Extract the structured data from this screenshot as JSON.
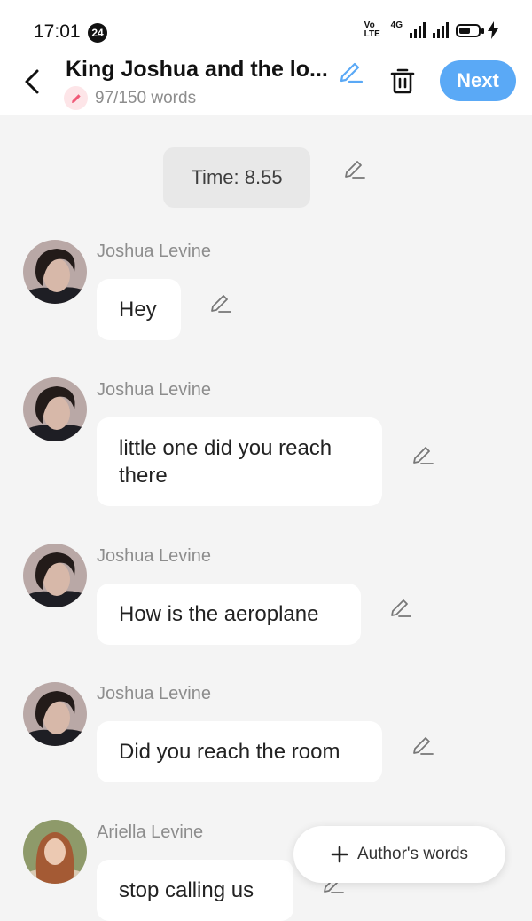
{
  "status": {
    "time": "17:01",
    "badge": "24",
    "volte": "Vo LTE",
    "network": "4G",
    "battery_level": 0.6
  },
  "header": {
    "title": "King Joshua and the lo...",
    "word_count": "97/150 words",
    "next_label": "Next"
  },
  "time_marker": "Time: 8.55",
  "messages": [
    {
      "sender": "Joshua Levine",
      "text": "Hey"
    },
    {
      "sender": "Joshua Levine",
      "text": "little one did you reach there"
    },
    {
      "sender": "Joshua Levine",
      "text": "How is the aeroplane"
    },
    {
      "sender": "Joshua Levine",
      "text": "Did you reach the room"
    },
    {
      "sender": "Ariella Levine",
      "text": "stop calling us"
    }
  ],
  "author_button": {
    "label": "Author's words"
  },
  "colors": {
    "accent": "#5aa9f6",
    "background": "#f4f4f4",
    "bubble": "#ffffff",
    "muted_text": "#8d8d8d",
    "word_icon": "#f05a78"
  },
  "icons": [
    "back-arrow-icon",
    "pencil-icon",
    "trash-icon",
    "plus-icon"
  ]
}
